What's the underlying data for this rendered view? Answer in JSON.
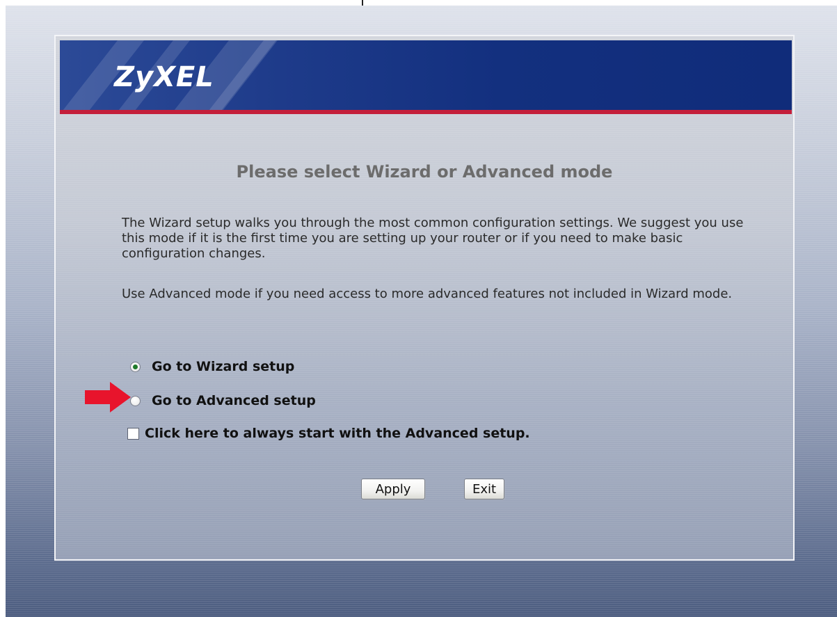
{
  "brand": {
    "logo_text": "ZyXEL"
  },
  "colors": {
    "banner_blue": "#13307f",
    "banner_accent_red": "#c41e3a",
    "arrow_red": "#e8142c",
    "radio_checked": "#1f7a2a"
  },
  "page": {
    "title": "Please select Wizard or Advanced mode",
    "paragraph_1": "The Wizard setup walks you through the most common configuration settings. We suggest you use this mode if it is the first time you are setting up your router or if you need to make basic configuration changes.",
    "paragraph_2": "Use Advanced mode if you need access to more advanced features not included in Wizard mode."
  },
  "options": {
    "wizard_label": "Go to Wizard setup",
    "wizard_selected": true,
    "advanced_label": "Go to Advanced setup",
    "advanced_selected": false,
    "always_advanced_label": "Click here to always start with the Advanced setup.",
    "always_advanced_checked": false
  },
  "annotation": {
    "arrow_icon": "red-arrow-right-icon"
  },
  "buttons": {
    "apply_label": "Apply",
    "exit_label": "Exit"
  }
}
